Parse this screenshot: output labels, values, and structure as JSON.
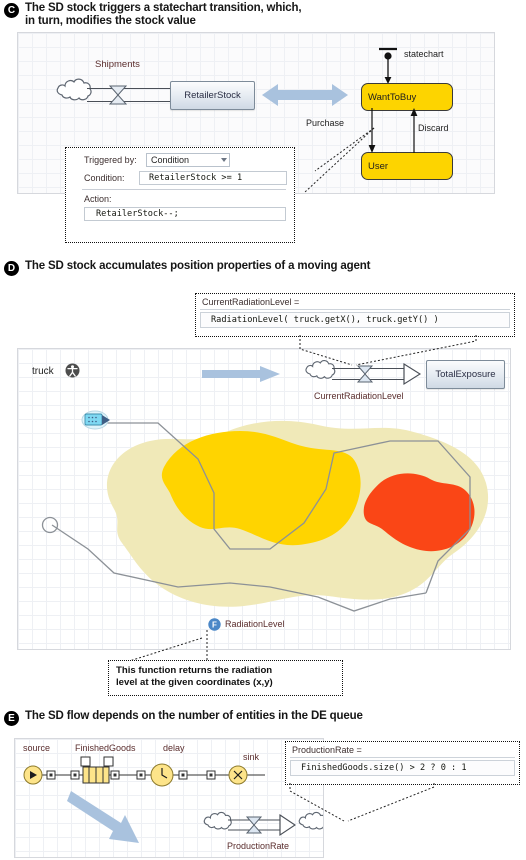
{
  "sections": [
    {
      "badge": "C",
      "title": "The SD stock triggers a statechart transition, which,\nin turn, modifies the stock value",
      "diagram": {
        "flow_label": "Shipments",
        "stock_label": "RetailerStock",
        "statechart_label": "statechart",
        "state_1": "WantToBuy",
        "state_2": "User",
        "transition_1": "Purchase",
        "transition_2": "Discard"
      },
      "properties": {
        "triggered_by_label": "Triggered by:",
        "triggered_by_value": "Condition",
        "condition_label": "Condition:",
        "condition_value": "RetailerStock >= 1",
        "action_label": "Action:",
        "action_value": "RetailerStock--;"
      }
    },
    {
      "badge": "D",
      "title": "The SD stock accumulates position properties of a moving agent",
      "callout": {
        "title": "CurrentRadiationLevel =",
        "code": "RadiationLevel( truck.getX(), truck.getY() )"
      },
      "diagram": {
        "agent_label": "truck",
        "flow_label": "CurrentRadiationLevel",
        "stock_label": "TotalExposure",
        "function_label": "RadiationLevel",
        "function_badge": "F"
      },
      "note": "This function returns the radiation\nlevel at the given coordinates (x,y)"
    },
    {
      "badge": "E",
      "title": "The SD flow depends on the number of entities in the DE queue",
      "diagram": {
        "source_label": "source",
        "queue_label": "FinishedGoods",
        "delay_label": "delay",
        "sink_label": "sink",
        "flow_label": "ProductionRate"
      },
      "callout": {
        "title": "ProductionRate =",
        "code": "FinishedGoods.size() > 2 ? 0 : 1"
      }
    }
  ],
  "colors": {
    "state_yellow": "#fdd400",
    "stock_blue_grey": "#cfd9e4",
    "fat_arrow_blue": "#a9c2de",
    "map_outer": "#f0e9b8",
    "map_mid": "#ffd400",
    "map_hot": "#fa4616",
    "badge_black": "#000000",
    "grid_line": "#eef0f4"
  }
}
